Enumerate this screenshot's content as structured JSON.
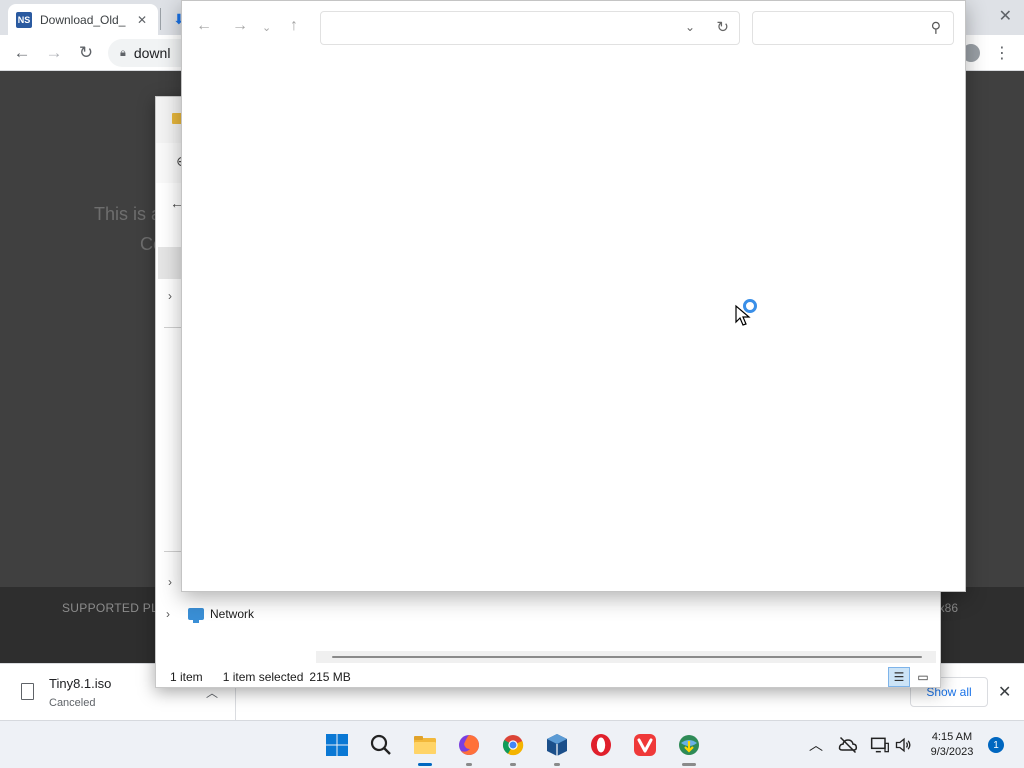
{
  "browser": {
    "tab_title": "Download_Old_",
    "tab_favicon": "NS",
    "url_partial": "downl"
  },
  "page": {
    "text_line1": "This is a",
    "text_line2": "Co",
    "footer_left": "SUPPORTED PLAT",
    "footer_right": "x86"
  },
  "download_shelf": {
    "file_name": "Tiny8.1.iso",
    "status": "Canceled",
    "show_all_label": "Show all"
  },
  "explorer": {
    "nav_network_label": "Network",
    "status_items": "1 item",
    "status_selected": "1 item selected",
    "status_size": "215 MB"
  },
  "taskbar": {
    "time": "4:15 AM",
    "date": "9/3/2023",
    "notification_count": "1"
  },
  "colors": {
    "accent": "#1a73e8",
    "windows_blue": "#0067c0",
    "page_bg": "#404040"
  }
}
